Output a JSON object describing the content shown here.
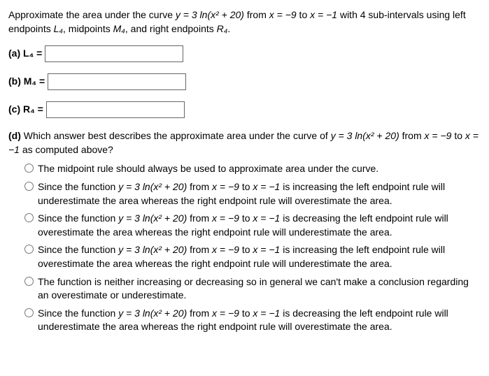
{
  "intro": {
    "pre": "Approximate the area under the curve ",
    "eq": "y = 3 ln(x² + 20)",
    "mid1": " from ",
    "x1": "x = −9",
    "mid2": " to ",
    "x2": "x = −1",
    "post": " with 4 sub-intervals using left endpoints ",
    "L": "L₄",
    "mid3": ", midpoints ",
    "M": "M₄",
    "mid4": ", and right endpoints ",
    "R": "R₄",
    "end": "."
  },
  "parts": {
    "a": "(a) L₄ =",
    "b": "(b) M₄ =",
    "c": "(c) R₄ ="
  },
  "d": {
    "label": "(d)",
    "pre": " Which answer best describes the approximate area under the curve of ",
    "eq": "y = 3 ln(x² + 20)",
    "mid1": " from ",
    "x1": "x = −9",
    "mid2": " to ",
    "x2": "x = −1",
    "post": " as computed above?"
  },
  "options": {
    "o1": "The midpoint rule should always be used to approximate area under the curve.",
    "o2": {
      "pre": "Since the function ",
      "eq": "y = 3 ln(x² + 20)",
      "mid1": " from ",
      "x1": "x = −9",
      "mid2": " to ",
      "x2": "x = −1",
      "post": " is increasing the left endpoint rule will underestimate the area whereas the right endpoint rule will overestimate the area."
    },
    "o3": {
      "pre": "Since the function ",
      "eq": "y = 3 ln(x² + 20)",
      "mid1": " from ",
      "x1": "x = −9",
      "mid2": " to ",
      "x2": "x = −1",
      "post": " is decreasing the left endpoint rule will overestimate the area whereas the right endpoint rule will underestimate the area."
    },
    "o4": {
      "pre": "Since the function ",
      "eq": "y = 3 ln(x² + 20)",
      "mid1": " from ",
      "x1": "x = −9",
      "mid2": " to ",
      "x2": "x = −1",
      "post": " is increasing the left endpoint rule will overestimate the area whereas the right endpoint rule will underestimate the area."
    },
    "o5": "The function is neither increasing or decreasing so in general we can't make a conclusion regarding an overestimate or underestimate.",
    "o6": {
      "pre": "Since the function ",
      "eq": "y = 3 ln(x² + 20)",
      "mid1": " from ",
      "x1": "x = −9",
      "mid2": " to ",
      "x2": "x = −1",
      "post": " is decreasing the left endpoint rule will underestimate the area whereas the right endpoint rule will overestimate the area."
    }
  }
}
